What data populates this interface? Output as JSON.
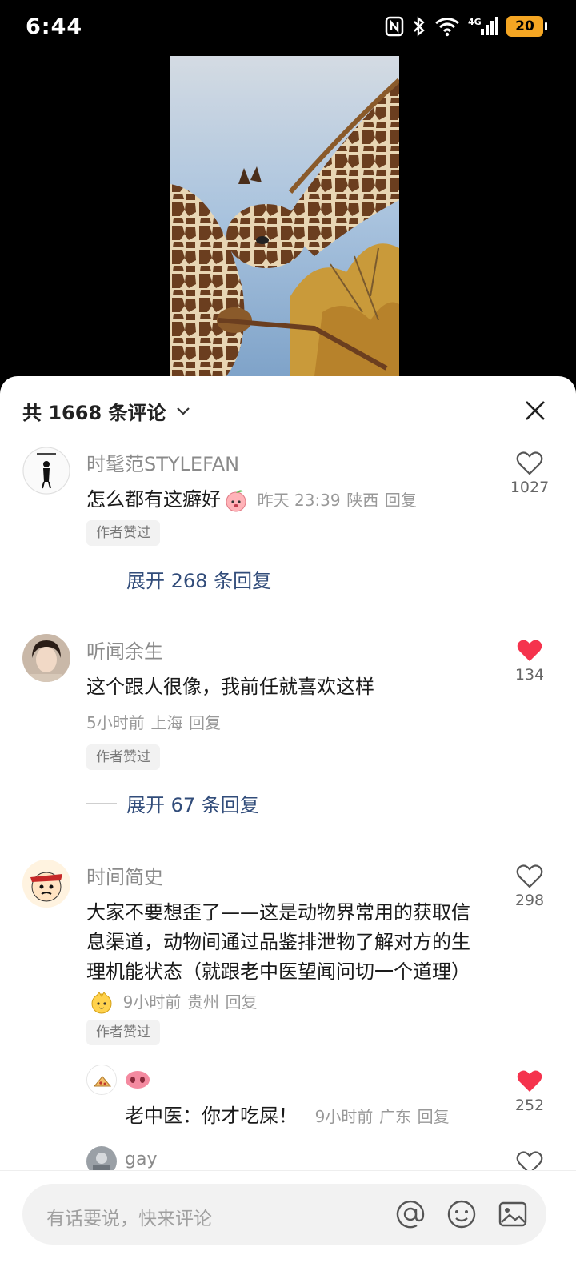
{
  "status_bar": {
    "time": "6:44",
    "battery": "20"
  },
  "sheet": {
    "comment_count": "共 1668 条评论"
  },
  "comments": [
    {
      "username": "时髦范STYLEFAN",
      "text": "怎么都有这癖好",
      "time": "昨天 23:39",
      "location": "陕西",
      "reply_label": "回复",
      "badge": "作者赞过",
      "expand": "展开 268 条回复",
      "likes": "1027",
      "liked": false
    },
    {
      "username": "听闻余生",
      "text": "这个跟人很像，我前任就喜欢这样",
      "time": "5小时前",
      "location": "上海",
      "reply_label": "回复",
      "badge": "作者赞过",
      "expand": "展开 67 条回复",
      "likes": "134",
      "liked": true
    },
    {
      "username": "时间简史",
      "text": "大家不要想歪了——这是动物界常用的获取信息渠道，动物间通过品鉴排泄物了解对方的生理机能状态（就跟老中医望闻问切一个道理）",
      "time": "9小时前",
      "location": "贵州",
      "reply_label": "回复",
      "badge": "作者赞过",
      "likes": "298",
      "liked": false
    }
  ],
  "reply": {
    "text": "老中医：你才吃屎！",
    "time": "9小时前",
    "location": "广东",
    "reply_label": "回复",
    "likes": "252",
    "liked": true
  },
  "next_comment": {
    "username": "gay"
  },
  "input": {
    "placeholder": "有话要说，快来评论"
  },
  "colors": {
    "like_red": "#f5334d",
    "link_blue": "#314c7a",
    "battery": "#f5a623"
  }
}
